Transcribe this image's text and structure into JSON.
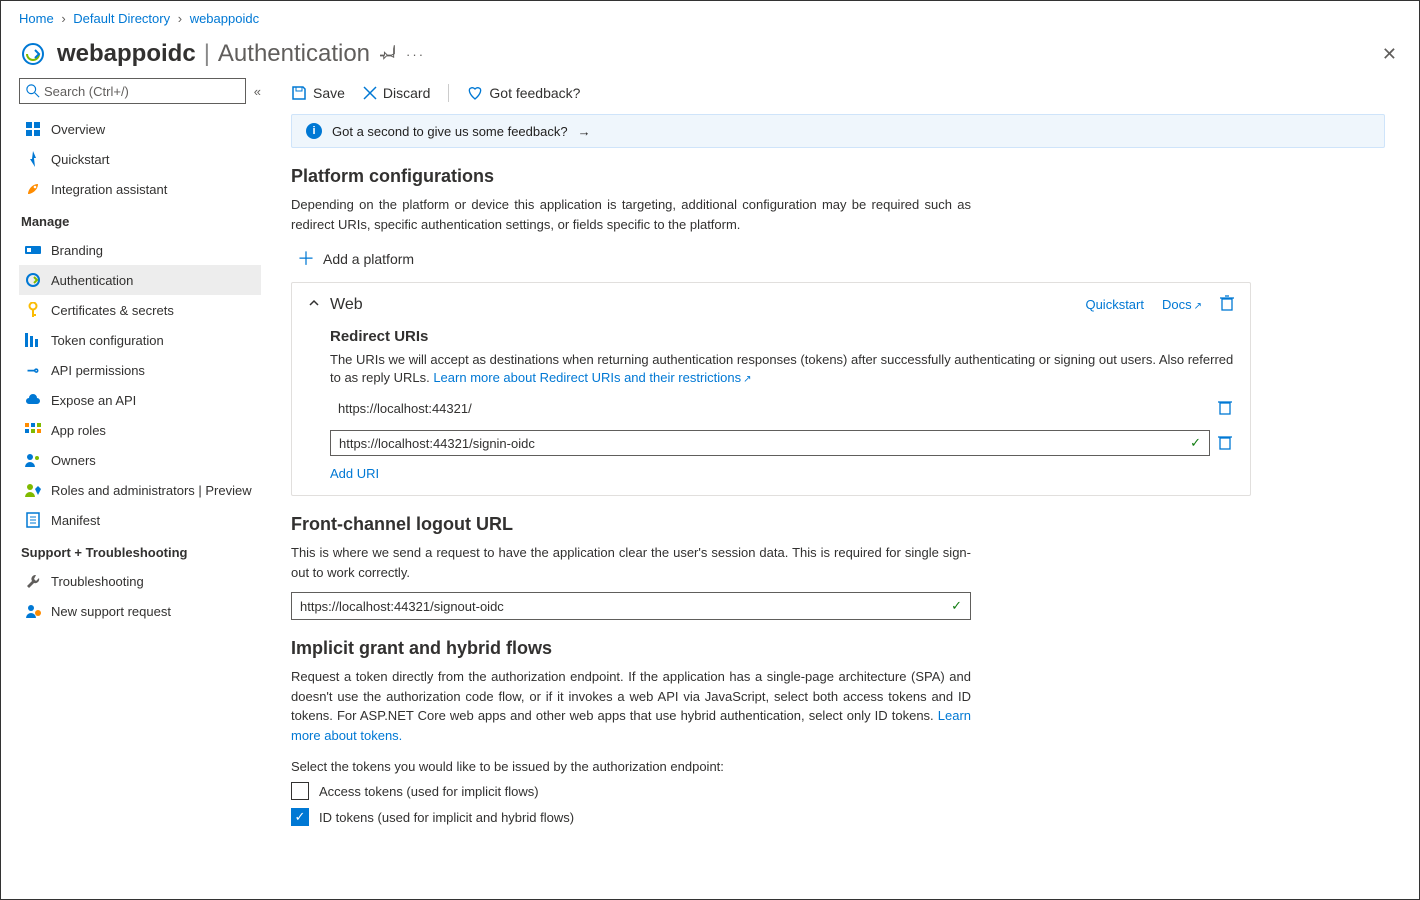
{
  "breadcrumb": {
    "home": "Home",
    "dir": "Default Directory",
    "app": "webappoidc"
  },
  "title": {
    "app": "webappoidc",
    "section": "Authentication"
  },
  "search_placeholder": "Search (Ctrl+/)",
  "sidebar": {
    "top": [
      {
        "label": "Overview"
      },
      {
        "label": "Quickstart"
      },
      {
        "label": "Integration assistant"
      }
    ],
    "manage_label": "Manage",
    "manage": [
      {
        "label": "Branding"
      },
      {
        "label": "Authentication"
      },
      {
        "label": "Certificates & secrets"
      },
      {
        "label": "Token configuration"
      },
      {
        "label": "API permissions"
      },
      {
        "label": "Expose an API"
      },
      {
        "label": "App roles"
      },
      {
        "label": "Owners"
      },
      {
        "label": "Roles and administrators | Preview"
      },
      {
        "label": "Manifest"
      }
    ],
    "support_label": "Support + Troubleshooting",
    "support": [
      {
        "label": "Troubleshooting"
      },
      {
        "label": "New support request"
      }
    ]
  },
  "cmd": {
    "save": "Save",
    "discard": "Discard",
    "feedback": "Got feedback?"
  },
  "feedback_bar": "Got a second to give us some feedback?",
  "platform": {
    "heading": "Platform configurations",
    "desc": "Depending on the platform or device this application is targeting, additional configuration may be required such as redirect URIs, specific authentication settings, or fields specific to the platform.",
    "add": "Add a platform",
    "web": {
      "name": "Web",
      "quickstart": "Quickstart",
      "docs": "Docs",
      "redirect_heading": "Redirect URIs",
      "redirect_desc": "The URIs we will accept as destinations when returning authentication responses (tokens) after successfully authenticating or signing out users. Also referred to as reply URLs. ",
      "redirect_link": "Learn more about Redirect URIs and their restrictions",
      "uri1": "https://localhost:44321/",
      "uri2": "https://localhost:44321/signin-oidc",
      "add_uri": "Add URI"
    }
  },
  "front_channel": {
    "heading": "Front-channel logout URL",
    "desc": "This is where we send a request to have the application clear the user's session data. This is required for single sign-out to work correctly.",
    "value": "https://localhost:44321/signout-oidc"
  },
  "implicit": {
    "heading": "Implicit grant and hybrid flows",
    "desc": "Request a token directly from the authorization endpoint. If the application has a single-page architecture (SPA) and doesn't use the authorization code flow, or if it invokes a web API via JavaScript, select both access tokens and ID tokens. For ASP.NET Core web apps and other web apps that use hybrid authentication, select only ID tokens. ",
    "link": "Learn more about tokens.",
    "select_label": "Select the tokens you would like to be issued by the authorization endpoint:",
    "access": "Access tokens (used for implicit flows)",
    "id": "ID tokens (used for implicit and hybrid flows)"
  }
}
